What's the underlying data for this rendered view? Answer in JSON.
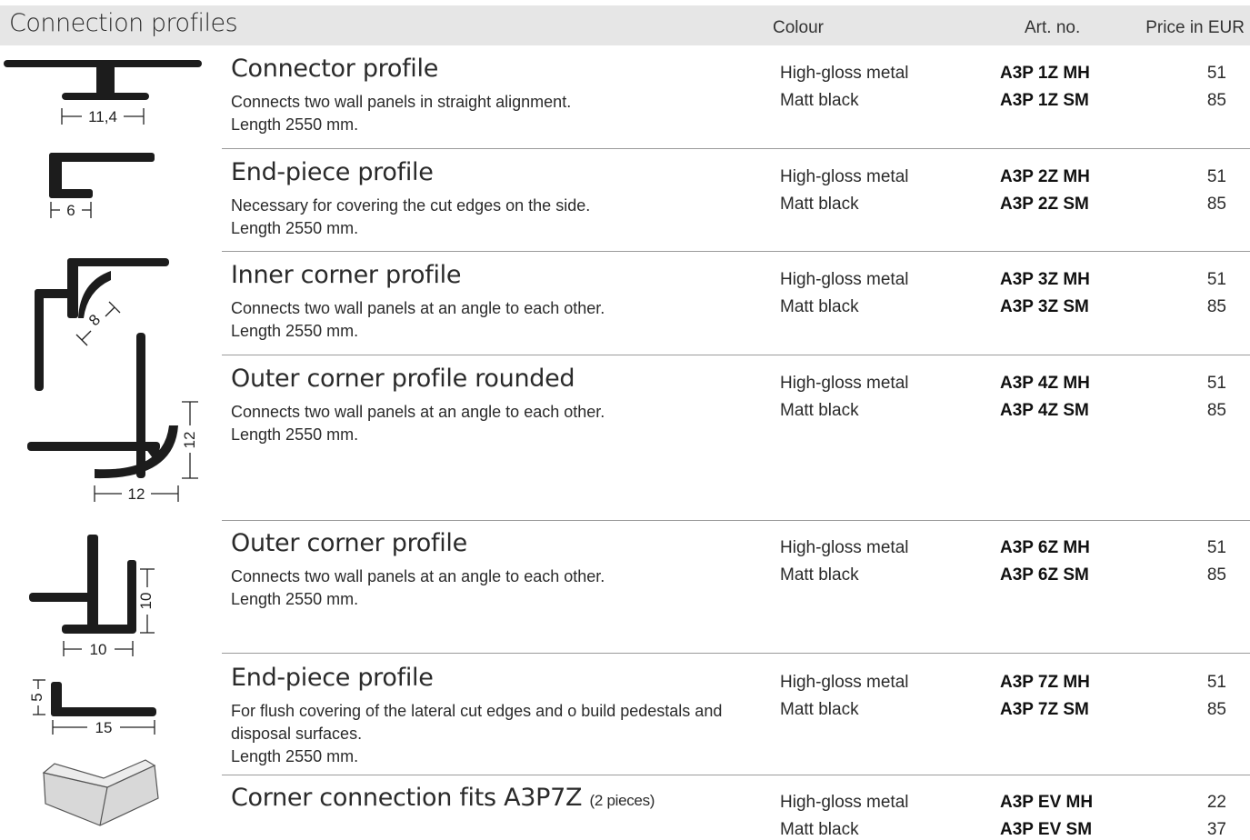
{
  "header": {
    "title": "Connection profiles",
    "col_colour": "Colour",
    "col_art": "Art. no.",
    "col_price": "Price in EUR"
  },
  "products": [
    {
      "name": "Connector profile",
      "description": "Connects two wall panels in straight alignment.",
      "length": "Length 2550 mm.",
      "variants": [
        {
          "colour": "High-gloss metal",
          "art": "A3P 1Z MH",
          "price": "51"
        },
        {
          "colour": "Matt black",
          "art": "A3P 1Z SM",
          "price": "85"
        }
      ],
      "dimensions": [
        "11,4"
      ]
    },
    {
      "name": "End-piece profile",
      "description": "Necessary for covering the cut edges on the side.",
      "length": "Length 2550 mm.",
      "variants": [
        {
          "colour": "High-gloss metal",
          "art": "A3P 2Z MH",
          "price": "51"
        },
        {
          "colour": "Matt black",
          "art": "A3P 2Z SM",
          "price": "85"
        }
      ],
      "dimensions": [
        "6"
      ]
    },
    {
      "name": "Inner corner profile",
      "description": "Connects two wall panels at an angle to each other.",
      "length": "Length 2550 mm.",
      "variants": [
        {
          "colour": "High-gloss metal",
          "art": "A3P 3Z MH",
          "price": "51"
        },
        {
          "colour": "Matt black",
          "art": "A3P 3Z SM",
          "price": "85"
        }
      ],
      "dimensions": [
        "8"
      ]
    },
    {
      "name": "Outer corner profile rounded",
      "description": "Connects two wall panels at an angle to each other.",
      "length": "Length 2550 mm.",
      "variants": [
        {
          "colour": "High-gloss metal",
          "art": "A3P 4Z MH",
          "price": "51"
        },
        {
          "colour": "Matt black",
          "art": "A3P 4Z SM",
          "price": "85"
        }
      ],
      "dimensions": [
        "12",
        "12"
      ]
    },
    {
      "name": "Outer corner profile",
      "description": "Connects two wall panels at an angle to each other.",
      "length": "Length 2550 mm.",
      "variants": [
        {
          "colour": "High-gloss metal",
          "art": "A3P 6Z MH",
          "price": "51"
        },
        {
          "colour": "Matt black",
          "art": "A3P 6Z SM",
          "price": "85"
        }
      ],
      "dimensions": [
        "10",
        "10"
      ]
    },
    {
      "name": "End-piece profile",
      "description": "For flush covering of the lateral cut edges and o build pedestals and disposal surfaces.",
      "length": "Length 2550 mm.",
      "variants": [
        {
          "colour": "High-gloss metal",
          "art": "A3P 7Z MH",
          "price": "51"
        },
        {
          "colour": "Matt black",
          "art": "A3P 7Z SM",
          "price": "85"
        }
      ],
      "dimensions": [
        "5",
        "15"
      ]
    },
    {
      "name": "Corner connection fits A3P7Z",
      "name_suffix": "(2 pieces)",
      "variants": [
        {
          "colour": "High-gloss metal",
          "art": "A3P EV MH",
          "price": "22"
        },
        {
          "colour": "Matt black",
          "art": "A3P EV SM",
          "price": "37"
        }
      ]
    }
  ]
}
